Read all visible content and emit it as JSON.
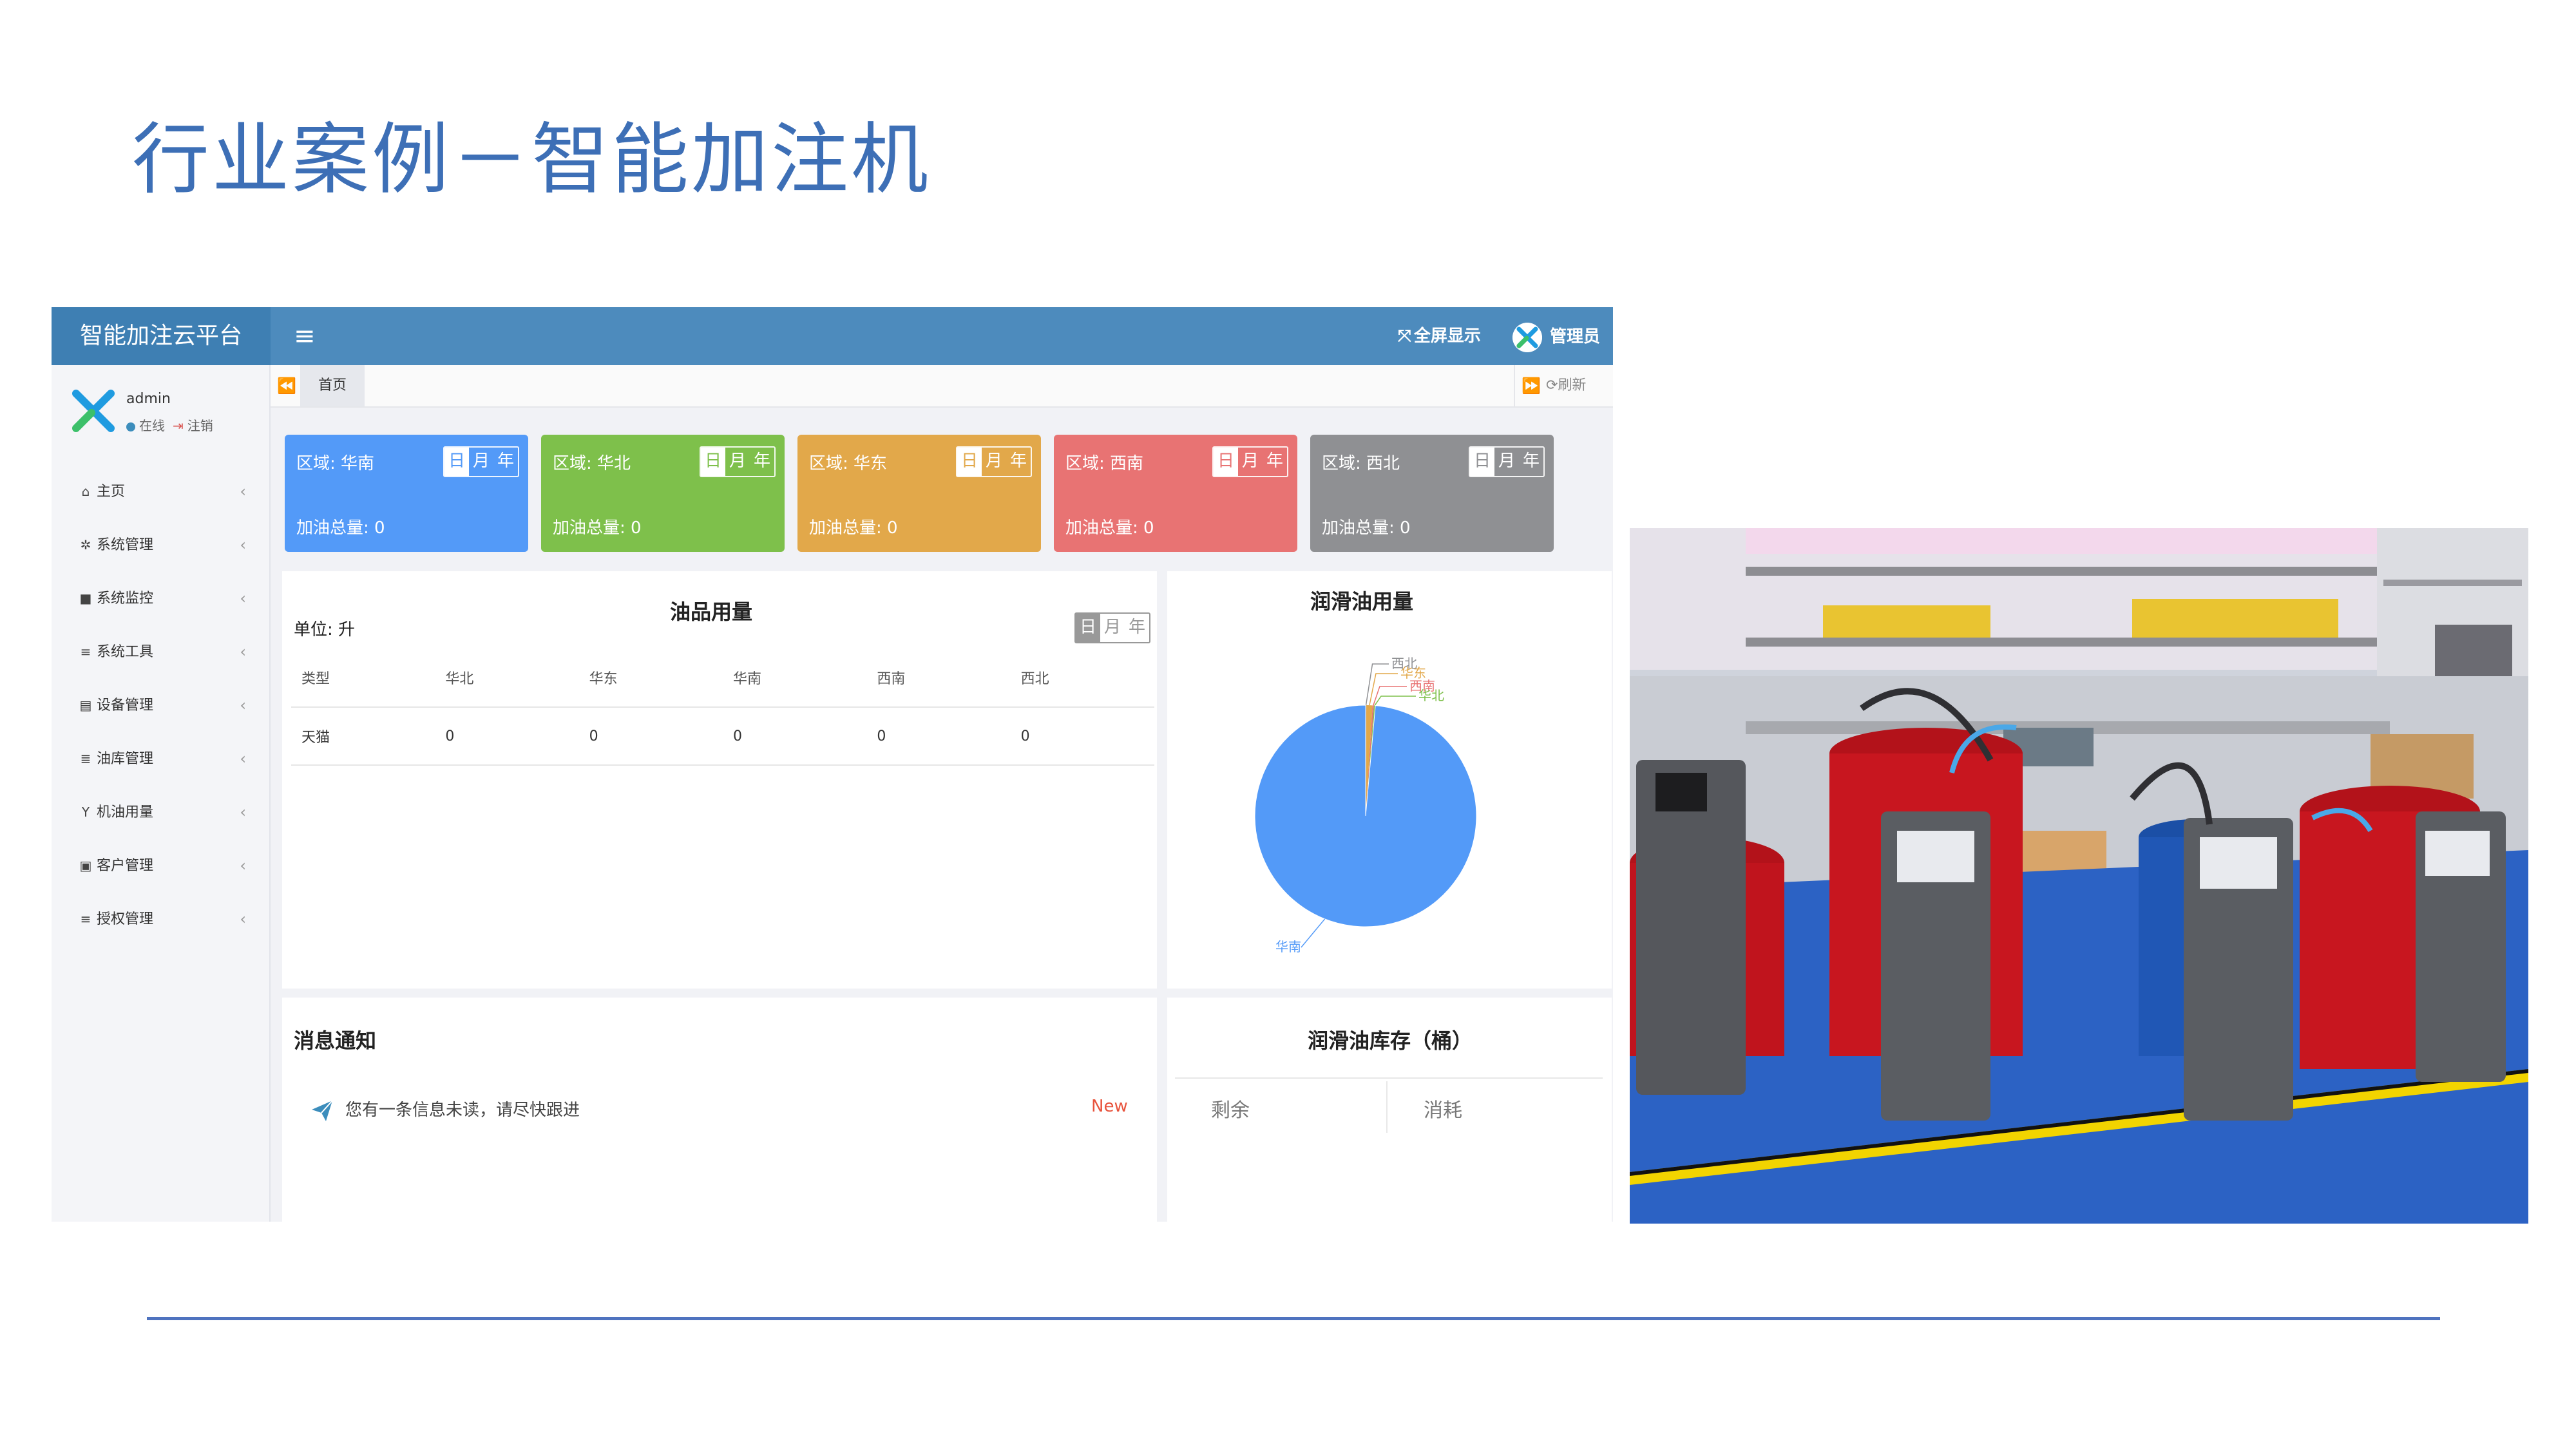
{
  "slide": {
    "title": "行业案例－智能加注机"
  },
  "app": {
    "brand": "智能加注云平台",
    "menu_icon": "≡",
    "fullscreen_icon": "⤧",
    "fullscreen_label": "全屏显示",
    "admin_label": "管理员",
    "accent_color": "#4d8bbd",
    "user": {
      "name": "admin",
      "status": "在线",
      "logout": "注销"
    },
    "sidebar": [
      {
        "icon": "home-icon",
        "glyph": "⌂",
        "label": "主页"
      },
      {
        "icon": "gear-icon",
        "glyph": "✲",
        "label": "系统管理"
      },
      {
        "icon": "camera-icon",
        "glyph": "■",
        "label": "系统监控"
      },
      {
        "icon": "list-icon",
        "glyph": "≡",
        "label": "系统工具"
      },
      {
        "icon": "device-icon",
        "glyph": "▤",
        "label": "设备管理"
      },
      {
        "icon": "database-icon",
        "glyph": "≣",
        "label": "油库管理"
      },
      {
        "icon": "filter-icon",
        "glyph": "Y",
        "label": "机油用量"
      },
      {
        "icon": "book-icon",
        "glyph": "▣",
        "label": "客户管理"
      },
      {
        "icon": "list-icon",
        "glyph": "≡",
        "label": "授权管理"
      }
    ],
    "tabs": {
      "prev": "⏪",
      "home": "首页",
      "next": "⏩",
      "refresh": "⟳刷新"
    },
    "regions": [
      {
        "label": "区域: 华南",
        "total": "加油总量: 0",
        "color": "#539af8"
      },
      {
        "label": "区域: 华北",
        "total": "加油总量: 0",
        "color": "#7ec04b"
      },
      {
        "label": "区域: 华东",
        "total": "加油总量: 0",
        "color": "#e2a84a"
      },
      {
        "label": "区域: 西南",
        "total": "加油总量: 0",
        "color": "#e87373"
      },
      {
        "label": "区域: 西北",
        "total": "加油总量: 0",
        "color": "#8f9093"
      }
    ],
    "periods": [
      "日",
      "月",
      "年"
    ],
    "usage": {
      "title": "油品用量",
      "unit": "单位: 升",
      "headers": [
        "类型",
        "华北",
        "华东",
        "华南",
        "西南",
        "西北"
      ],
      "rows": [
        [
          "天猫",
          "0",
          "0",
          "0",
          "0",
          "0"
        ]
      ]
    },
    "lube": {
      "title": "润滑油用量"
    },
    "messages": {
      "title": "消息通知",
      "text": "您有一条信息未读，请尽快跟进",
      "badge": "New"
    },
    "stock": {
      "title": "润滑油库存（桶）",
      "remaining": "剩余",
      "consumed": "消耗"
    }
  },
  "chart_data": {
    "type": "pie",
    "title": "润滑油用量",
    "categories": [
      "西北",
      "华东",
      "西南",
      "华北",
      "华南"
    ],
    "values": [
      0.1,
      0.9,
      0.2,
      0.2,
      98.6
    ],
    "colors": [
      "#8f9093",
      "#e2a84a",
      "#e87373",
      "#7ec04b",
      "#539af8"
    ],
    "legend": "bottom"
  }
}
